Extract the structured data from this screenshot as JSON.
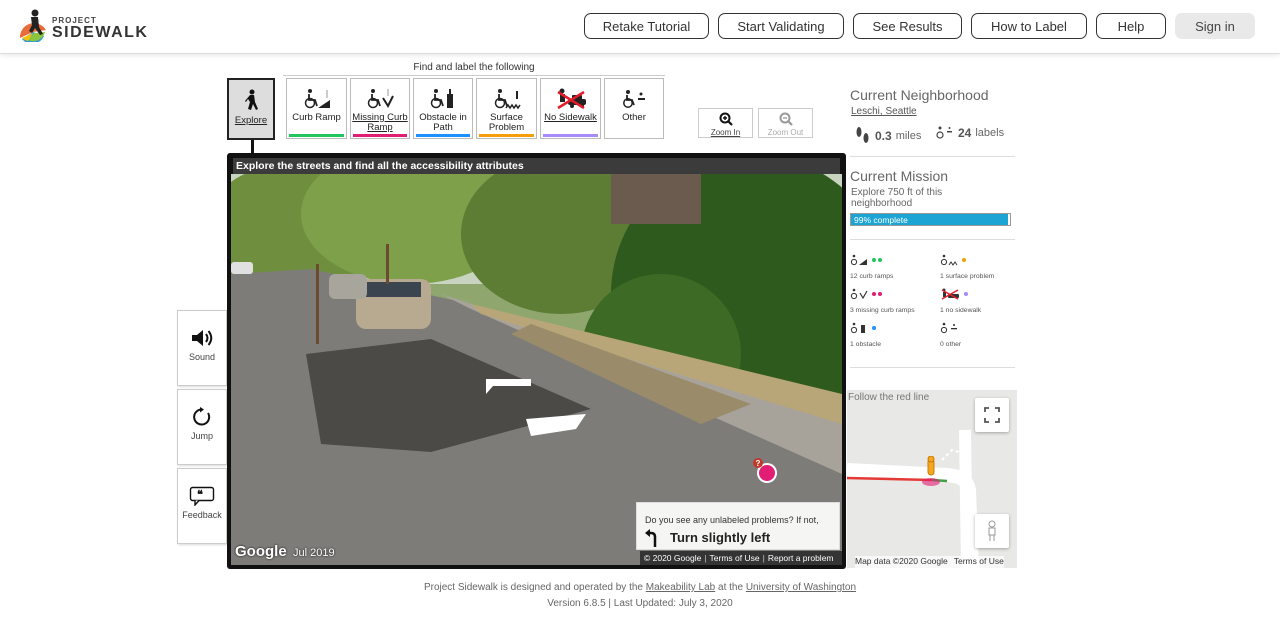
{
  "header": {
    "logo_project": "PROJECT",
    "logo_sidewalk": "SIDEWALK",
    "nav": [
      "Retake Tutorial",
      "Start Validating",
      "See Results",
      "How to Label",
      "Help"
    ],
    "signin": "Sign in"
  },
  "toolbar": {
    "title": "Find and label the following",
    "explore": "Explore",
    "tools": [
      {
        "label": "Curb Ramp",
        "color": "#22c55e"
      },
      {
        "label": "Missing Curb Ramp",
        "color": "#e11d74"
      },
      {
        "label": "Obstacle in Path",
        "color": "#1e90ff"
      },
      {
        "label": "Surface Problem",
        "color": "#f59e0b"
      },
      {
        "label": "No Sidewalk",
        "color": "#a78bfa"
      },
      {
        "label": "Other",
        "color": "#ffffff"
      }
    ],
    "zoom_in": "Zoom In",
    "zoom_out": "Zoom Out"
  },
  "side": {
    "sound": "Sound",
    "jump": "Jump",
    "feedback": "Feedback"
  },
  "streetview": {
    "header": "Explore the streets and find all the accessibility attributes",
    "google": "Google",
    "date": "Jul 2019",
    "question": "Do you see any unlabeled problems? If not,",
    "action": "Turn slightly left",
    "footer": [
      "© 2020 Google",
      "Terms of Use",
      "Report a problem"
    ]
  },
  "neighborhood": {
    "title": "Current Neighborhood",
    "name": "Leschi, Seattle",
    "miles": "0.3",
    "miles_unit": "miles",
    "labels": "24",
    "labels_unit": "labels"
  },
  "mission": {
    "title": "Current Mission",
    "desc": "Explore 750 ft of this neighborhood",
    "progress_text": "99% complete",
    "progress": 0.99
  },
  "counts": [
    {
      "text": "12 curb ramps",
      "color": "#22c55e"
    },
    {
      "text": "1 surface problem",
      "color": "#f59e0b"
    },
    {
      "text": "3 missing curb ramps",
      "color": "#e11d74"
    },
    {
      "text": "1 no sidewalk",
      "color": "#a78bfa"
    },
    {
      "text": "1 obstacle",
      "color": "#1e90ff"
    },
    {
      "text": "0 other",
      "color": "#999999"
    }
  ],
  "map": {
    "hint": "Follow the red line",
    "footer": [
      "Map data ©2020 Google",
      "Terms of Use"
    ]
  },
  "footer": {
    "line1_a": "Project Sidewalk is designed and operated by the",
    "lab": "Makeability Lab",
    "line1_b": "at the",
    "uni": "University of Washington",
    "line2": "Version 6.8.5 | Last Updated: July 3, 2020"
  }
}
